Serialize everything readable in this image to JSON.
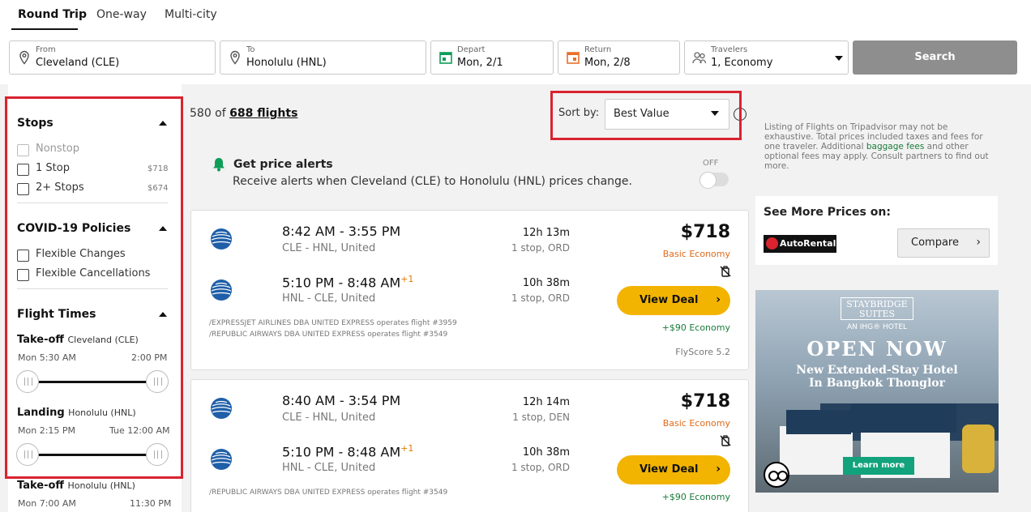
{
  "tabs": [
    "Round Trip",
    "One-way",
    "Multi-city"
  ],
  "search": {
    "from_label": "From",
    "from_value": "Cleveland (CLE)",
    "to_label": "To",
    "to_value": "Honolulu (HNL)",
    "depart_label": "Depart",
    "depart_value": "Mon, 2/1",
    "return_label": "Return",
    "return_value": "Mon, 2/8",
    "travelers_label": "Travelers",
    "travelers_value": "1, Economy",
    "search_button": "Search"
  },
  "filters": {
    "stops_heading": "Stops",
    "stops": [
      {
        "label": "Nonstop",
        "price": "",
        "disabled": true
      },
      {
        "label": "1 Stop",
        "price": "$718",
        "disabled": false
      },
      {
        "label": "2+ Stops",
        "price": "$674",
        "disabled": false
      }
    ],
    "covid_heading": "COVID-19 Policies",
    "covid": [
      {
        "label": "Flexible Changes"
      },
      {
        "label": "Flexible Cancellations"
      }
    ],
    "times_heading": "Flight Times",
    "takeoff1": {
      "title": "Take-off",
      "place": "Cleveland (CLE)",
      "min": "Mon 5:30 AM",
      "max": "2:00 PM"
    },
    "landing1": {
      "title": "Landing",
      "place": "Honolulu (HNL)",
      "min": "Mon 2:15 PM",
      "max": "Tue 12:00 AM"
    },
    "takeoff2": {
      "title": "Take-off",
      "place": "Honolulu (HNL)",
      "min": "Mon 7:00 AM",
      "max": "11:30 PM"
    }
  },
  "results": {
    "count_prefix": "580 of ",
    "count_link": "688 flights",
    "sort_label": "Sort by:",
    "sort_value": "Best Value",
    "info": "i"
  },
  "alert": {
    "title": "Get price alerts",
    "subtitle": "Receive alerts when Cleveland (CLE) to Honolulu (HNL) prices change.",
    "toggle_label": "OFF"
  },
  "flights": [
    {
      "out_times": "8:42 AM - 3:55 PM",
      "out_route": "CLE - HNL, United",
      "out_dur": "12h 13m",
      "out_stops": "1 stop, ORD",
      "ret_times": "5:10 PM - 8:48 AM",
      "ret_plus": "+1",
      "ret_route": "HNL - CLE, United",
      "ret_dur": "10h 38m",
      "ret_stops": "1 stop, ORD",
      "price": "$718",
      "cabin": "Basic Economy",
      "deal": "View Deal",
      "upsell": "+$90 Economy",
      "operated": [
        "/EXPRESSJET AIRLINES DBA UNITED EXPRESS operates flight #3959",
        "/REPUBLIC AIRWAYS DBA UNITED EXPRESS operates flight #3549"
      ],
      "flyscore": "FlyScore 5.2"
    },
    {
      "out_times": "8:40 AM - 3:54 PM",
      "out_route": "CLE - HNL, United",
      "out_dur": "12h 14m",
      "out_stops": "1 stop, DEN",
      "ret_times": "5:10 PM - 8:48 AM",
      "ret_plus": "+1",
      "ret_route": "HNL - CLE, United",
      "ret_dur": "10h 38m",
      "ret_stops": "1 stop, ORD",
      "price": "$718",
      "cabin": "Basic Economy",
      "deal": "View Deal",
      "upsell": "+$90 Economy",
      "operated": [
        "/REPUBLIC AIRWAYS DBA UNITED EXPRESS operates flight #3549"
      ]
    }
  ],
  "sidebar": {
    "disclaimer_1": "Listing of Flights on Tripadvisor may not be exhaustive. Total prices included taxes and fees for one traveler. Additional ",
    "disclaimer_link": "baggage fees",
    "disclaimer_2": " and other optional fees may apply. Consult partners to find out more.",
    "more_prices_title": "See More Prices on:",
    "partner": "AutoRentals",
    "compare": "Compare"
  },
  "ad": {
    "logo": "STAYBRIDGE SUITES",
    "ihg": "AN IHG® HOTEL",
    "headline": "OPEN NOW",
    "line1": "New Extended-Stay Hotel",
    "line2": "In Bangkok Thonglor",
    "cta": "Learn more"
  },
  "colors": {
    "accent_yellow": "#f2b400",
    "highlight_red": "#d9232f",
    "green": "#1a7a3a",
    "orange": "#e06a1a"
  }
}
